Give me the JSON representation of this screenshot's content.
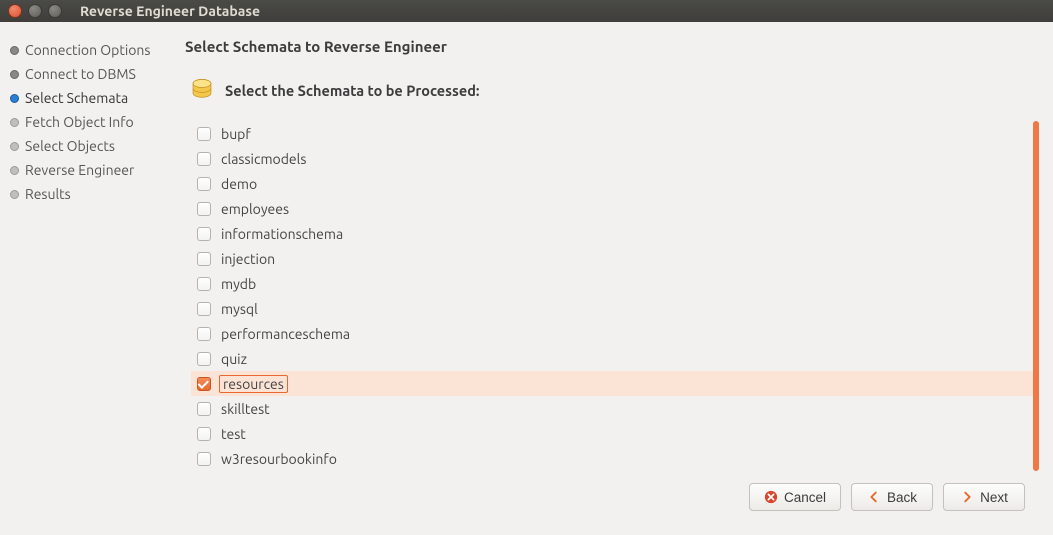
{
  "window": {
    "title": "Reverse Engineer Database"
  },
  "steps": [
    {
      "label": "Connection Options",
      "state": "done"
    },
    {
      "label": "Connect to DBMS",
      "state": "done"
    },
    {
      "label": "Select Schemata",
      "state": "current"
    },
    {
      "label": "Fetch Object Info",
      "state": "future"
    },
    {
      "label": "Select Objects",
      "state": "future"
    },
    {
      "label": "Reverse Engineer",
      "state": "future"
    },
    {
      "label": "Results",
      "state": "future"
    }
  ],
  "main": {
    "heading": "Select Schemata to Reverse Engineer",
    "subhead": "Select the Schemata to be Processed:",
    "schemata": [
      {
        "name": "bupf",
        "checked": false,
        "selected": false
      },
      {
        "name": "classicmodels",
        "checked": false,
        "selected": false
      },
      {
        "name": "demo",
        "checked": false,
        "selected": false
      },
      {
        "name": "employees",
        "checked": false,
        "selected": false
      },
      {
        "name": "informationschema",
        "checked": false,
        "selected": false
      },
      {
        "name": "injection",
        "checked": false,
        "selected": false
      },
      {
        "name": "mydb",
        "checked": false,
        "selected": false
      },
      {
        "name": "mysql",
        "checked": false,
        "selected": false
      },
      {
        "name": "performanceschema",
        "checked": false,
        "selected": false
      },
      {
        "name": "quiz",
        "checked": false,
        "selected": false
      },
      {
        "name": "resources",
        "checked": true,
        "selected": true
      },
      {
        "name": "skilltest",
        "checked": false,
        "selected": false
      },
      {
        "name": "test",
        "checked": false,
        "selected": false
      },
      {
        "name": "w3resourbookinfo",
        "checked": false,
        "selected": false
      }
    ]
  },
  "buttons": {
    "cancel": "Cancel",
    "back": "Back",
    "next": "Next"
  },
  "colors": {
    "accent": "#e8682f",
    "selection_bg": "#fbe3d6"
  }
}
